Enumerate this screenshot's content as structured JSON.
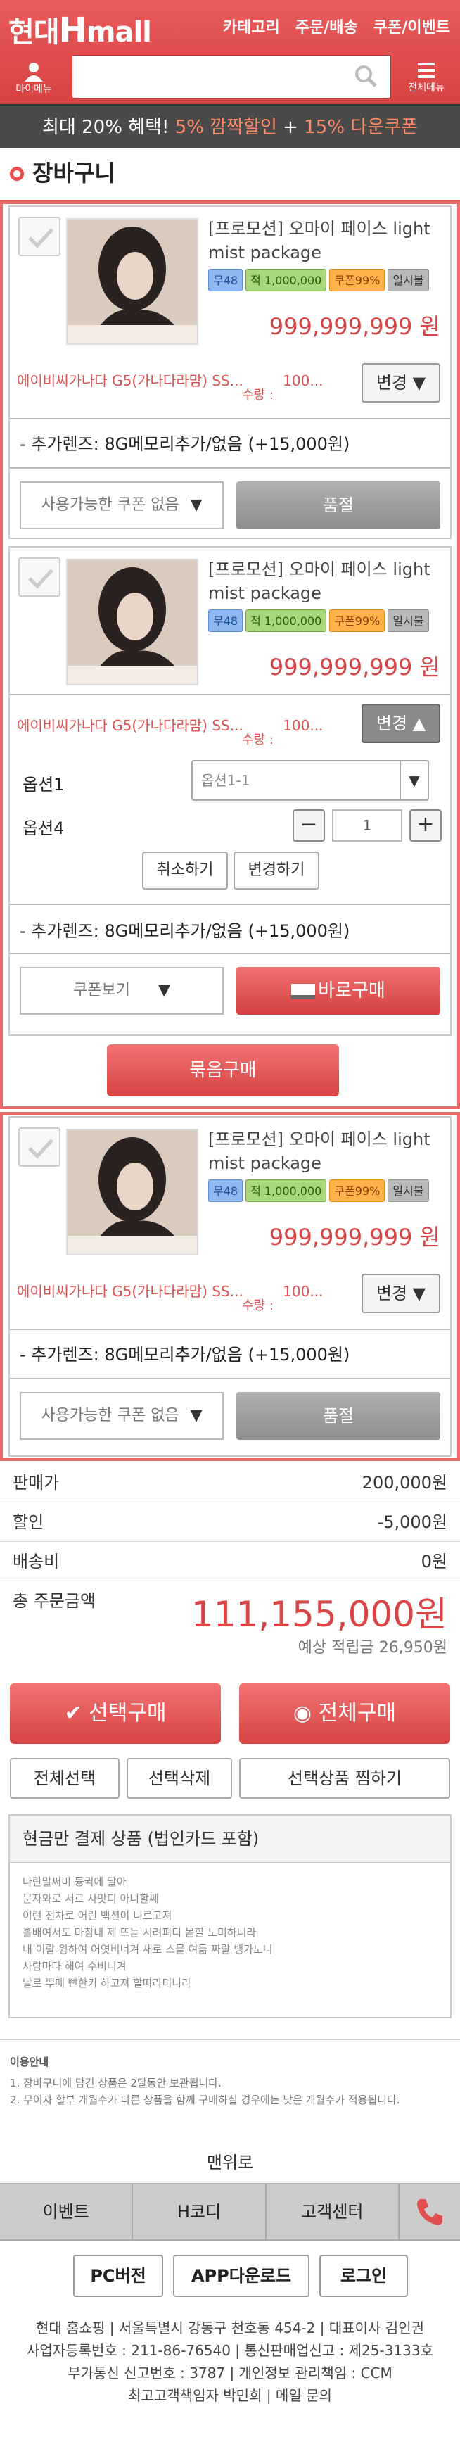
{
  "header": {
    "logo_a": "현대",
    "logo_b": "H",
    "logo_c": "mall",
    "nav": [
      "카테고리",
      "주문/배송",
      "쿠폰/이벤트"
    ],
    "my_label": "마이메뉴",
    "all_label": "전체메뉴",
    "search_placeholder": ""
  },
  "promo": {
    "a": "최대 20% 혜택!",
    "b": "5% 깜짝할인",
    "c": "+",
    "d": "15% 다운쿠폰"
  },
  "page_title": "장바구니",
  "items": [
    {
      "name": "[프로모션] 오마이 페이스 light mist package",
      "badges": [
        "무48",
        "적 1,000,000",
        "쿠폰99%",
        "일시불"
      ],
      "price": "999,999,999 원",
      "option": "에이비씨가나다 G5(가나다라맘) SS...",
      "option_tail": "100...",
      "qty_label": "수량 :",
      "change": "변경",
      "addl": "- 추가렌즈: 8G메모리추가/없음 (+15,000원)",
      "coupon": "사용가능한 쿠폰 없음",
      "soldout": "품절"
    },
    {
      "name": "[프로모션] 오마이 페이스 light mist package",
      "badges": [
        "무48",
        "적 1,000,000",
        "쿠폰99%",
        "일시불"
      ],
      "price": "999,999,999 원",
      "option": "에이비씨가나다 G5(가나다라맘) SS...",
      "option_tail": "100...",
      "qty_label": "수량 :",
      "change": "변경",
      "opt1_label": "옵션1",
      "opt1_value": "옵션1-1",
      "opt4_label": "옵션4",
      "opt4_qty": "1",
      "cancel": "취소하기",
      "apply": "변경하기",
      "addl": "- 추가렌즈: 8G메모리추가/없음 (+15,000원)",
      "coupon": "쿠폰보기",
      "buy_now": "바로구매"
    },
    {
      "name": "[프로모션] 오마이 페이스 light mist package",
      "badges": [
        "무48",
        "적 1,000,000",
        "쿠폰99%",
        "일시불"
      ],
      "price": "999,999,999 원",
      "option": "에이비씨가나다 G5(가나다라맘) SS...",
      "option_tail": "100...",
      "qty_label": "수량 :",
      "change": "변경",
      "addl": "- 추가렌즈: 8G메모리추가/없음 (+15,000원)",
      "coupon": "사용가능한 쿠폰 없음",
      "soldout": "품절"
    }
  ],
  "group_buy": "묶음구매",
  "summary": {
    "price_label": "판매가",
    "price": "200,000원",
    "discount_label": "할인",
    "discount": "-5,000원",
    "ship_label": "배송비",
    "ship": "0원",
    "total_label": "총 주문금액",
    "total": "111,155,000원",
    "points": "예상 적립금 26,950원"
  },
  "actions": {
    "buy_selected": "선택구매",
    "buy_all": "전체구매",
    "select_all": "전체선택",
    "delete_selected": "선택삭제",
    "wish_selected": "선택상품 찜하기"
  },
  "cash": {
    "title": "현금만 결제 상품 (법인카드 포함)",
    "lines": [
      "나란말써미 듕귁에 달아",
      "문자와로 서르 사맛디 아니할쎄",
      "이런 전차로 어린 백션이 니르고져",
      "홀배여서도 마참내 제 뜨듣 시려펴디 몯할 노미하니라",
      "내 이랄 윙하여 어엿비너겨 새로 스믈 여듦 짜랄 뱅가노니",
      "사람마다 해여 수비니겨",
      "날로 뿌메 뼌한키 하고져 할따라미니라"
    ]
  },
  "guide": {
    "title": "이용안내",
    "lines": [
      "1. 장바구니에 담긴 상품은 2달동안 보관됩니다.",
      "2. 무이자 할부 개월수가 다른 상품을 함께 구매하실 경우에는 낮은 개월수가 적용됩니다."
    ]
  },
  "to_top": "맨위로",
  "footer": {
    "nav": [
      "이벤트",
      "H코디",
      "고객센터"
    ],
    "buttons": [
      "PC버전",
      "APP다운로드",
      "로그인"
    ],
    "corp": [
      "현대 홈쇼핑 | 서울특별시 강동구 천호동 454-2 | 대표이사 김인권",
      "사업자등록번호 : 211-86-76540 | 통신판매업신고 : 제25-3133호",
      "부가통신 신고번호 : 3787 | 개인정보 관리책임 : CCM",
      "최고고객책임자 박민희 | 메일 문의"
    ]
  },
  "colors": {
    "brand": "#e05050",
    "price": "#d94545"
  }
}
